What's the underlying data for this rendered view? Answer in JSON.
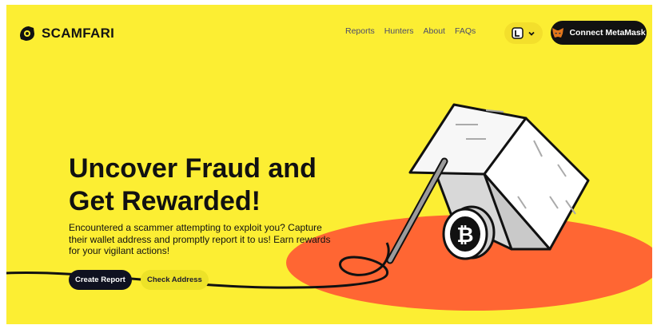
{
  "brand": {
    "name": "SCAMFARI"
  },
  "nav": {
    "items": [
      {
        "label": "Reports"
      },
      {
        "label": "Hunters"
      },
      {
        "label": "About"
      },
      {
        "label": "FAQs"
      }
    ]
  },
  "header": {
    "language_icon": "language-glyph-icon",
    "chevron_icon": "chevron-down-icon",
    "connect_label": "Connect MetaMask",
    "connect_icon": "metamask-fox-icon"
  },
  "hero": {
    "title": "Uncover Fraud and Get Rewarded!",
    "description": "Encountered a scammer attempting to exploit you? Capture their wallet address and promptly report it to us! Earn rewards for your vigilant actions!",
    "primary_button": "Create Report",
    "secondary_button": "Check Address"
  },
  "illustration": {
    "coin_symbol": "₿"
  },
  "colors": {
    "background": "#fcee33",
    "accent": "#ff6633",
    "dark": "#111111"
  }
}
